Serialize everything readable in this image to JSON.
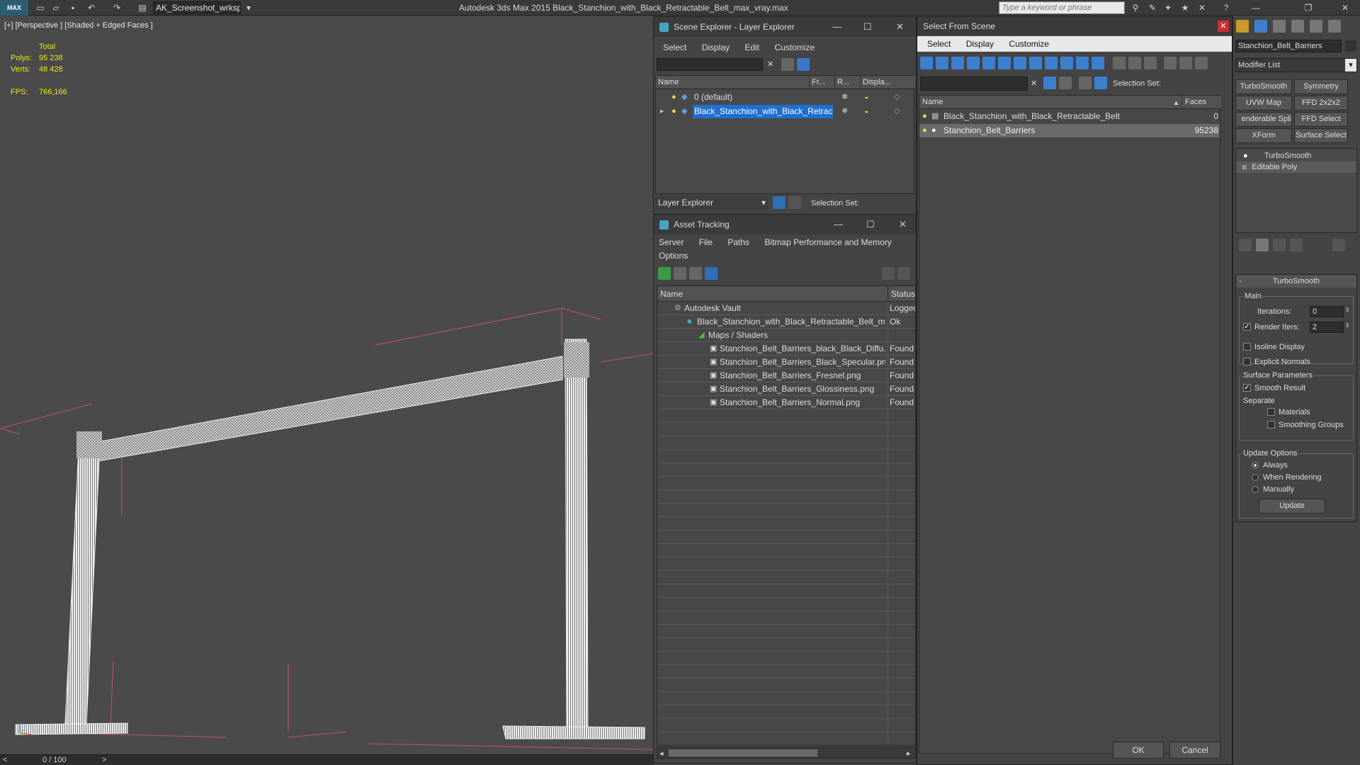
{
  "app": {
    "logo": "MAX",
    "workspace": "AK_Screenshot_wrksp",
    "title": "Autodesk 3ds Max  2015     Black_Stanchion_with_Black_Retractable_Belt_max_vray.max",
    "search_placeholder": "Type a keyword or phrase"
  },
  "viewport": {
    "label": "[+] [Perspective ] [Shaded + Edged Faces ]",
    "total_label": "Total",
    "polys_label": "Polys:",
    "polys_value": "95 238",
    "verts_label": "Verts:",
    "verts_value": "48 428",
    "fps_label": "FPS:",
    "fps_value": "766,166"
  },
  "timeline": {
    "prev": "<",
    "frame": "0 / 100",
    "next": ">"
  },
  "scene_explorer": {
    "title": "Scene Explorer - Layer Explorer",
    "menu": [
      "Select",
      "Display",
      "Edit",
      "Customize"
    ],
    "col_name": "Name",
    "col_frozen": "Fr...",
    "col_render": "R...",
    "col_display": "Displa...",
    "rows": [
      {
        "name": "0 (default)"
      },
      {
        "name": "Black_Stanchion_with_Black_Retracta..."
      }
    ],
    "footer_dropdown": "Layer Explorer",
    "selection_set_label": "Selection Set:"
  },
  "asset_tracking": {
    "title": "Asset Tracking",
    "menu": [
      "Server",
      "File",
      "Paths",
      "Bitmap Performance and Memory"
    ],
    "menu2": [
      "Options"
    ],
    "col_name": "Name",
    "col_status": "Status",
    "rows": [
      {
        "name": "Autodesk Vault",
        "status": "Logged"
      },
      {
        "name": "Black_Stanchion_with_Black_Retractable_Belt_m...",
        "status": "Ok"
      },
      {
        "name": "Maps / Shaders",
        "status": ""
      },
      {
        "name": "Stanchion_Belt_Barriers_black_Black_Diffu...",
        "status": "Found"
      },
      {
        "name": "Stanchion_Belt_Barriers_Black_Specular.png",
        "status": "Found"
      },
      {
        "name": "Stanchion_Belt_Barriers_Fresnel.png",
        "status": "Found"
      },
      {
        "name": "Stanchion_Belt_Barriers_Glossiness.png",
        "status": "Found"
      },
      {
        "name": "Stanchion_Belt_Barriers_Normal.png",
        "status": "Found"
      }
    ]
  },
  "select_from_scene": {
    "title": "Select From Scene",
    "menu": [
      "Select",
      "Display",
      "Customize"
    ],
    "selection_set_label": "Selection Set:",
    "col_name": "Name",
    "col_faces": "Faces",
    "rows": [
      {
        "name": "Black_Stanchion_with_Black_Retractable_Belt",
        "faces": "0"
      },
      {
        "name": "Stanchion_Belt_Barriers",
        "faces": "95238"
      }
    ],
    "ok_label": "OK",
    "cancel_label": "Cancel"
  },
  "command_panel": {
    "object_name": "Stanchion_Belt_Barriers",
    "modifier_list": "Modifier List",
    "buttons": [
      "TurboSmooth",
      "Symmetry",
      "UVW Map",
      "FFD 2x2x2",
      "enderable Spli",
      "FFD Select",
      "XForm",
      "Surface Select"
    ],
    "stack": [
      "TurboSmooth",
      "Editable Poly"
    ],
    "rollout_title": "TurboSmooth",
    "main_label": "Main",
    "iterations_label": "Iterations:",
    "iterations_value": "0",
    "render_iters_label": "Render Iters:",
    "render_iters_value": "2",
    "isoline_label": "Isoline Display",
    "explicit_normals_label": "Explicit Normals",
    "surface_params_label": "Surface Parameters",
    "smooth_result_label": "Smooth Result",
    "separate_label": "Separate",
    "materials_label": "Materials",
    "smoothing_groups_label": "Smoothing Groups",
    "update_options_label": "Update Options",
    "always_label": "Always",
    "when_rendering_label": "When Rendering",
    "manually_label": "Manually",
    "update_button": "Update"
  },
  "colors": {
    "selection_blue": "#1f6fd1",
    "viewport_bg": "#4a4a4a",
    "stat_yellow": "#e8e818",
    "wire_pink": "#c8506e"
  }
}
